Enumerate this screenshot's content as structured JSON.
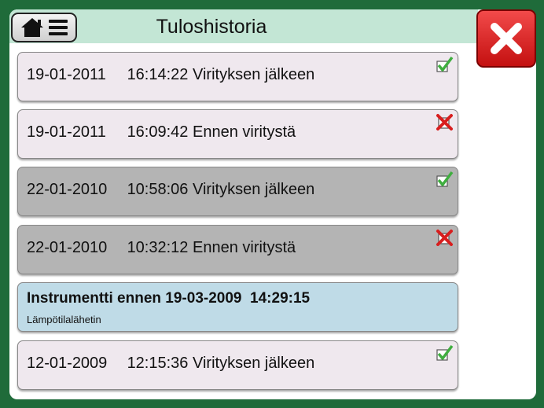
{
  "header": {
    "title": "Tuloshistoria",
    "home_icon": "home-icon",
    "menu_icon": "menu-icon",
    "close_icon": "close-icon"
  },
  "results": [
    {
      "date": "19-01-2011",
      "time": "16:14:22",
      "label": "Virityksen jälkeen",
      "status": "pass"
    },
    {
      "date": "19-01-2011",
      "time": "16:09:42",
      "label": "Ennen viritystä",
      "status": "fail"
    },
    {
      "date": "22-01-2010",
      "time": "10:58:06",
      "label": "Virityksen jälkeen",
      "status": "pass"
    },
    {
      "date": "22-01-2010",
      "time": "10:32:12",
      "label": "Ennen viritystä",
      "status": "fail"
    }
  ],
  "instrument": {
    "title": "Instrumentti ennen 19-03-2009  14:29:15",
    "subtitle": "Lämpötilalähetin"
  },
  "last_result": {
    "date": "12-01-2009",
    "time": "12:15:36",
    "label": "Virityksen jälkeen",
    "status": "pass"
  },
  "colors": {
    "frame": "#1f6b3a",
    "header": "#c3e6d5",
    "close": "#e02020",
    "pass": "#3fae3f",
    "fail": "#d81e1e"
  }
}
